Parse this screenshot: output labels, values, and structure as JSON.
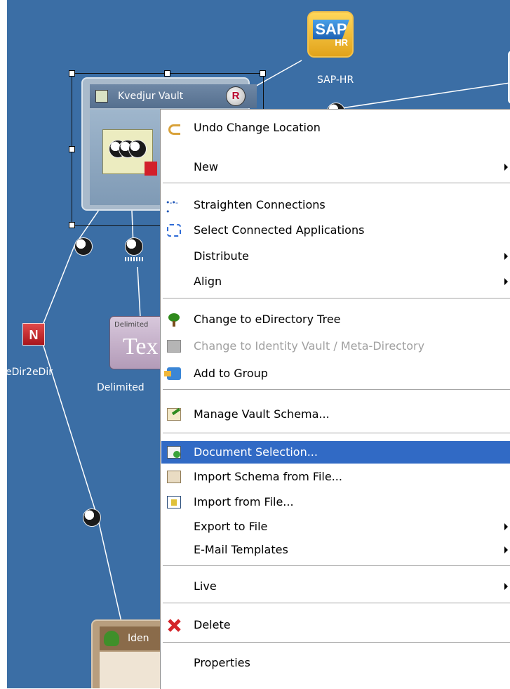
{
  "canvas": {
    "background": "#3b6ea5",
    "nodes": {
      "sap": {
        "word": "SAP",
        "sub": "HR",
        "label": "SAP-HR"
      },
      "vault": {
        "title": "Kvedjur Vault",
        "badge": "R"
      },
      "delimited": {
        "small": "Delimited",
        "big": "Tex",
        "label": "Delimited"
      },
      "edir": {
        "glyph": "N",
        "label": "eDir2eDir"
      },
      "identity_vault": {
        "title": "Iden"
      }
    }
  },
  "context_menu": {
    "highlight": "#316ac5",
    "items": [
      {
        "label": "Undo Change Location",
        "icon": "undo-icon"
      },
      {
        "label": "New",
        "submenu": true
      },
      {
        "label": "Straighten Connections",
        "icon": "straighten-connections-icon"
      },
      {
        "label": "Select Connected Applications",
        "icon": "select-applications-icon"
      },
      {
        "label": "Distribute",
        "submenu": true
      },
      {
        "label": "Align",
        "submenu": true
      },
      {
        "label": "Change to eDirectory Tree",
        "icon": "tree-icon"
      },
      {
        "label": "Change to Identity Vault / Meta-Directory",
        "icon": "identity-vault-icon",
        "disabled": true
      },
      {
        "label": "Add to Group",
        "icon": "add-group-icon"
      },
      {
        "label": "Manage Vault Schema...",
        "icon": "schema-icon"
      },
      {
        "label": "Document Selection...",
        "icon": "document-icon",
        "selected": true
      },
      {
        "label": "Import Schema from File...",
        "icon": "import-schema-icon"
      },
      {
        "label": "Import from File...",
        "icon": "import-file-icon"
      },
      {
        "label": "Export to File",
        "submenu": true
      },
      {
        "label": "E-Mail Templates",
        "submenu": true
      },
      {
        "label": "Live",
        "submenu": true
      },
      {
        "label": "Delete",
        "icon": "delete-icon"
      },
      {
        "label": "Properties"
      }
    ]
  }
}
